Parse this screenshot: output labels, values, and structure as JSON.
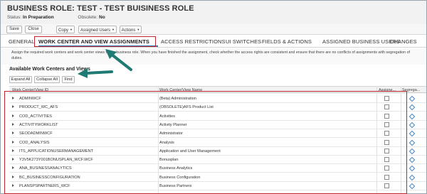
{
  "header": {
    "title": "BUSINESS ROLE: TEST - TEST BUISINESS ROLE",
    "status_label": "Status:",
    "status_value": "In Preparation",
    "obsolete_label": "Obsolete:",
    "obsolete_value": "No"
  },
  "toolbar": {
    "save": "Save",
    "close": "Close",
    "copy": "Copy",
    "assigned_users": "Assigned Users",
    "actions": "Actions"
  },
  "tabs": [
    {
      "label": "GENERAL"
    },
    {
      "label": "WORK CENTER AND VIEW ASSIGNMENTS"
    },
    {
      "label": "ACCESS RESTRICTIONS"
    },
    {
      "label": "UI SWITCHES"
    },
    {
      "label": "FIELDS & ACTIONS"
    },
    {
      "label": "ASSIGNED BUSINESS USERS"
    },
    {
      "label": "CHANGES"
    }
  ],
  "info_text": "Assign the required work centers and work center views to the business role. When you have finished the assignment, check whether the access rights are consistent and ensure that there are no conflicts of assignments with segregation of duties.",
  "section": {
    "title": "Available Work Centers and Views",
    "expand_all": "Expand All",
    "collapse_all": "Collapse All",
    "find": "Find"
  },
  "table": {
    "columns": [
      "Work Center/View ID",
      "Work Center/View Name",
      "Assigne...",
      "Segrega..."
    ],
    "rows": [
      {
        "id": "ADMINWCF",
        "name": "(Beta) Administration"
      },
      {
        "id": "PRODUCT_WC_AFS",
        "name": "(OBSOLETE)AFS Product List"
      },
      {
        "id": "COD_ACTIVITIES",
        "name": "Activities"
      },
      {
        "id": "ACTIVITYWORKLIST",
        "name": "Activity Planner"
      },
      {
        "id": "SEODADMINWCF",
        "name": "Administrator"
      },
      {
        "id": "COD_ANALYSIS",
        "name": "Analysis"
      },
      {
        "id": "ITS_APPLICATIONUSERMANAGEMENT",
        "name": "Application and User Management"
      },
      {
        "id": "Y3V5K273Y001BONUSPLAN_WCF.WCF",
        "name": "Bonusplan"
      },
      {
        "id": "ANA_BUSINESSANALYTICS",
        "name": "Business Analytics"
      },
      {
        "id": "BC_BUSINESSCONFIGURATION",
        "name": "Business Configuration"
      },
      {
        "id": "PLANSPSPARTNERS_WCF",
        "name": "Business Partners"
      }
    ]
  },
  "colors": {
    "highlight_red": "#c0262d",
    "annotation_teal": "#1e7a72",
    "tab_underline": "#2a7ab8"
  }
}
